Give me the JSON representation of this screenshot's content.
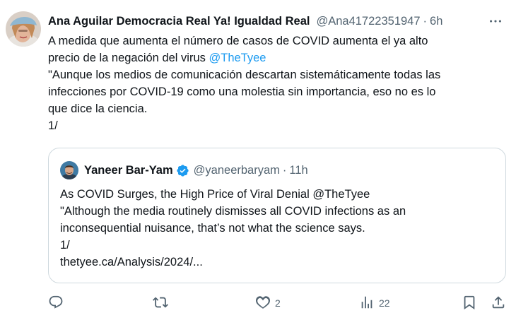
{
  "tweet": {
    "author_name": "Ana Aguilar Democracia Real Ya! Igualdad Real",
    "handle": "@Ana41722351947",
    "separator": "·",
    "time": "6h",
    "body_lines": [
      {
        "text": "A medida que aumenta el número de casos de COVID aumenta el ya alto",
        "mention": ""
      },
      {
        "text": "precio de la negación del virus ",
        "mention": "@TheTyee"
      },
      {
        "text": "\"Aunque los medios de comunicación descartan sistemáticamente todas las",
        "mention": ""
      },
      {
        "text": "infecciones por COVID-19 como una molestia sin importancia, eso no es lo",
        "mention": ""
      },
      {
        "text": "que dice la ciencia.",
        "mention": ""
      },
      {
        "text": "1/",
        "mention": ""
      }
    ]
  },
  "quote": {
    "author_name": "Yaneer Bar-Yam",
    "handle": "@yaneerbaryam",
    "separator": "·",
    "time": "11h",
    "body_lines": [
      "As COVID Surges, the High Price of Viral Denial @TheTyee",
      "\"Although the media routinely dismisses all COVID infections as an",
      "inconsequential nuisance, that’s not what the science says.",
      "1/",
      "thetyee.ca/Analysis/2024/..."
    ]
  },
  "actions": {
    "reply_icon": "reply-icon",
    "retweet_icon": "retweet-icon",
    "like_icon": "heart-icon",
    "like_count": "2",
    "views_icon": "views-icon",
    "views_count": "22",
    "bookmark_icon": "bookmark-icon",
    "share_icon": "share-icon"
  },
  "colors": {
    "text": "#0f1419",
    "secondary": "#536471",
    "link": "#1d9bf0",
    "border": "#cfd9de",
    "verified": "#1d9bf0"
  }
}
